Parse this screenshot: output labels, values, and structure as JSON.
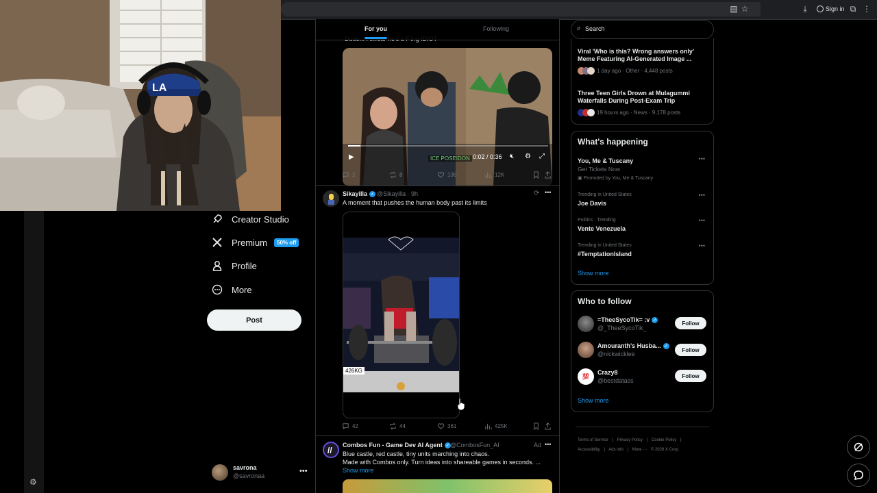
{
  "browser": {
    "signin_label": "Sign in"
  },
  "sidebar": {
    "items": [
      {
        "label": "Creator Studio",
        "icon": "rocket-icon"
      },
      {
        "label": "Premium",
        "icon": "x-logo-icon",
        "badge": "50% off"
      },
      {
        "label": "Profile",
        "icon": "person-icon"
      },
      {
        "label": "More",
        "icon": "more-circle-icon"
      }
    ],
    "post_label": "Post",
    "account": {
      "name": "savrona",
      "handle": "@savronaa"
    }
  },
  "feed": {
    "tabs": [
      "For you",
      "Following"
    ],
    "cut_text": "Dude... I swear he's a F'ing IDIOT",
    "tweet1": {
      "video_time": "0:02 / 0:36",
      "watermark": "ICE POSEIDON",
      "replies": "2",
      "reposts": "8",
      "likes": "136",
      "views": "12K"
    },
    "tweet2": {
      "name": "Sikayilla",
      "handle": "@Sikayilla",
      "time": "9h",
      "text": "A moment that pushes the human body past its limits",
      "media_label": "426KG",
      "replies": "42",
      "reposts": "44",
      "likes": "361",
      "views": "425K"
    },
    "tweet3": {
      "name": "Combos Fun - Game Dev AI Agent",
      "handle": "@CombosFun_AI",
      "ad_label": "Ad",
      "line1": "Blue castle, red castle, tiny units marching into chaos.",
      "line2": "Made with Combos only. Turn ideas into shareable games in seconds. ...",
      "show_more": "Show more"
    }
  },
  "right": {
    "search_placeholder": "Search",
    "trending_top": [
      {
        "title": "Viral 'Who is this? Wrong answers only' Meme Featuring AI-Generated Image ...",
        "meta": "1 day ago · Other · 4,448 posts"
      },
      {
        "title": "Three Teen Girls Drown at Mulagummi Waterfalls During Post-Exam Trip",
        "meta": "19 hours ago · News · 9,178 posts"
      }
    ],
    "happening": {
      "title": "What's happening",
      "items": [
        {
          "context": "",
          "title": "You, Me & Tuscany",
          "sub": "Get Tickets Now",
          "promo": "Promoted by You, Me & Tuscany"
        },
        {
          "context": "Trending in United States",
          "title": "Joe Davis"
        },
        {
          "context": "Politics · Trending",
          "title": "Vente Venezuela"
        },
        {
          "context": "Trending in United States",
          "title": "#TemptationIsland"
        }
      ],
      "show_more": "Show more"
    },
    "who_to_follow": {
      "title": "Who to follow",
      "users": [
        {
          "name": "=TheeSycoTik= :v",
          "handle": "@_TheeSycoTik_",
          "verified": true
        },
        {
          "name": "Amouranth's Husba...",
          "handle": "@nickwicklee",
          "verified": true
        },
        {
          "name": "Crazy8",
          "handle": "@bestdatass",
          "verified": false
        }
      ],
      "follow_label": "Follow",
      "show_more": "Show more"
    },
    "footer": {
      "links": [
        "Terms of Service",
        "|",
        "Privacy Policy",
        "|",
        "Cookie Policy",
        "|"
      ],
      "links2": [
        "Accessibility",
        "|",
        "Ads info",
        "|",
        "More ···",
        "© 2026 X Corp."
      ]
    }
  }
}
